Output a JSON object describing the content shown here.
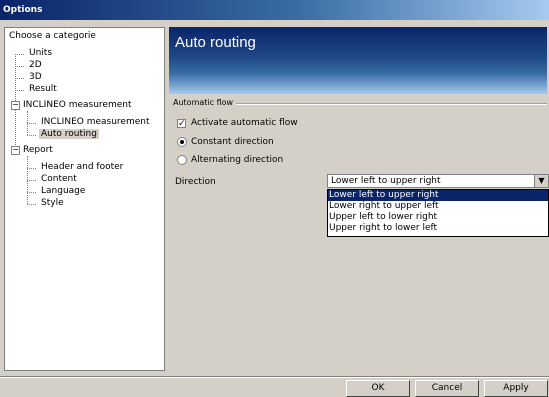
{
  "window": {
    "title": "Options"
  },
  "sidebar": {
    "header": "Choose a categorie",
    "items": [
      {
        "label": "Units"
      },
      {
        "label": "2D"
      },
      {
        "label": "3D"
      },
      {
        "label": "Result"
      },
      {
        "label": "INCLINEO measurement"
      },
      {
        "label": "INCLINEO measurement"
      },
      {
        "label": "Auto routing"
      },
      {
        "label": "Report"
      },
      {
        "label": "Header and footer"
      },
      {
        "label": "Content"
      },
      {
        "label": "Language"
      },
      {
        "label": "Style"
      }
    ],
    "expander_symbol": "−",
    "selected": "Auto routing"
  },
  "main": {
    "title": "Auto routing",
    "group_label": "Automatic flow",
    "activate_label": "Activate automatic flow",
    "activate_checked": true,
    "check_mark": "✓",
    "radio_constant": "Constant direction",
    "radio_alternating": "Alternating direction",
    "radio_selected": "Constant direction",
    "direction_label": "Direction",
    "direction_value": "Lower left to upper right",
    "dropdown_arrow": "▼",
    "direction_options": [
      "Lower left to upper right",
      "Lower right to upper left",
      "Upper left to lower right",
      "Upper right to lower left"
    ]
  },
  "buttons": {
    "ok": "OK",
    "cancel": "Cancel",
    "apply": "Apply"
  },
  "colors": {
    "title_bar": "#0a246a",
    "banner": "#1f4888",
    "selection": "#0a246a",
    "face": "#d4d0c8"
  }
}
